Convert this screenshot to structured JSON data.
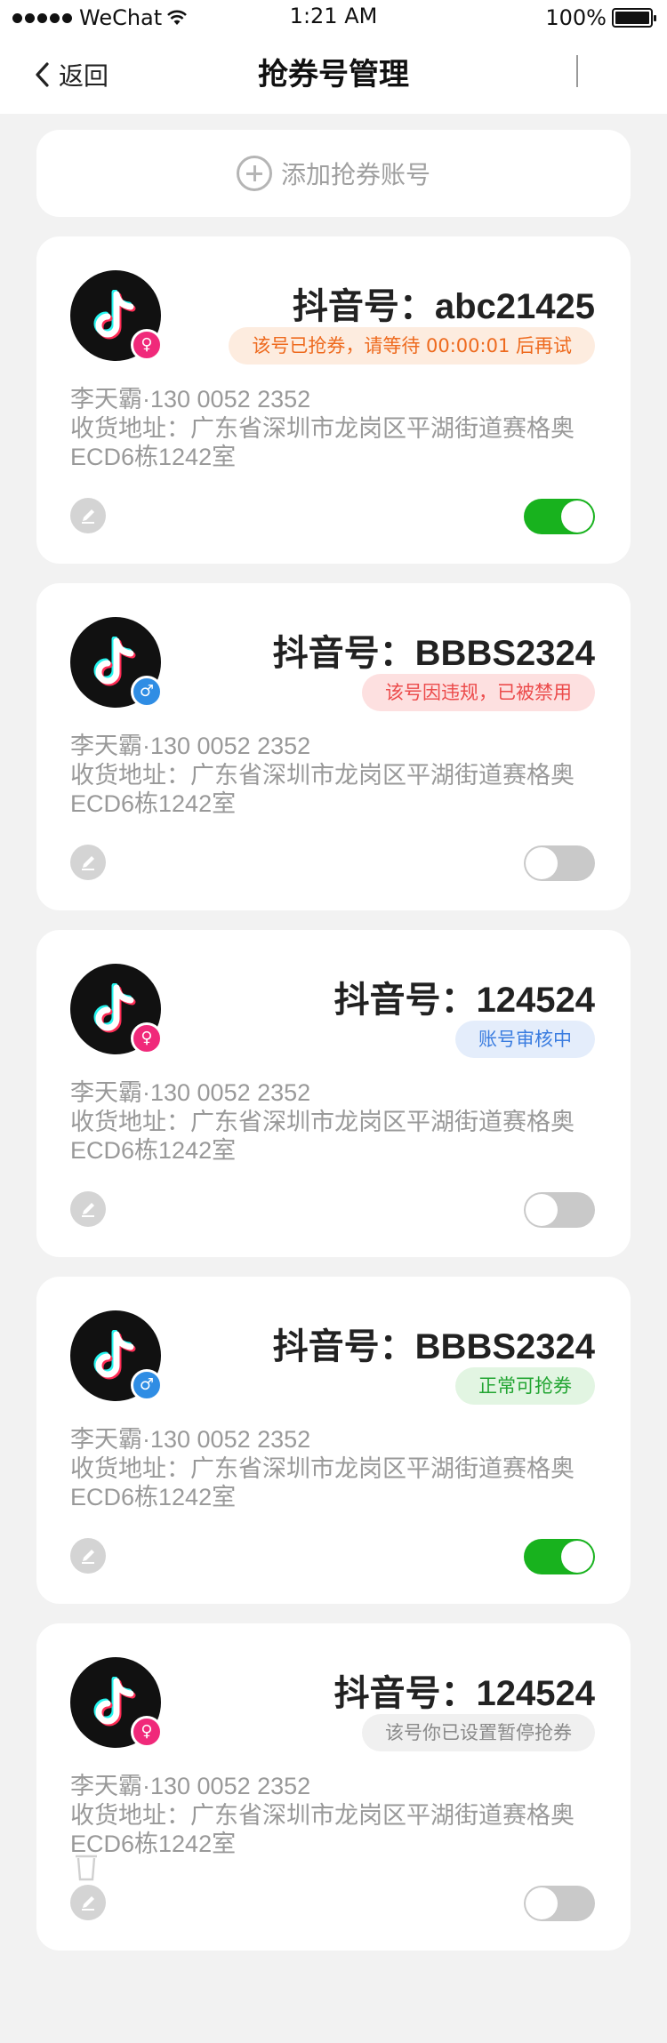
{
  "status_bar": {
    "carrier": "WeChat",
    "time": "1:21 AM",
    "battery": "100%"
  },
  "nav": {
    "back_label": "返回",
    "title": "抢券号管理"
  },
  "add_button": {
    "label": "添加抢券账号"
  },
  "colors": {
    "toggle_on": "#18b21e",
    "toggle_off": "#c9c9c9",
    "female": "#f0297a",
    "male": "#2f8de4"
  },
  "cards": [
    {
      "account": "抖音号：abc21425",
      "gender": "female",
      "status": "该号已抢券，请等待 00:00:01 后再试",
      "status_type": "orange",
      "contact": "李天霸·130 0052 2352",
      "address": "收货地址：广东省深圳市龙岗区平湖街道赛格奥ECD6栋1242室",
      "enabled": true
    },
    {
      "account": "抖音号：BBBS2324",
      "gender": "male",
      "status": "该号因违规，已被禁用",
      "status_type": "red",
      "contact": "李天霸·130 0052 2352",
      "address": "收货地址：广东省深圳市龙岗区平湖街道赛格奥ECD6栋1242室",
      "enabled": false
    },
    {
      "account": "抖音号：124524",
      "gender": "female",
      "status": "账号审核中",
      "status_type": "blue",
      "contact": "李天霸·130 0052 2352",
      "address": "收货地址：广东省深圳市龙岗区平湖街道赛格奥ECD6栋1242室",
      "enabled": false
    },
    {
      "account": "抖音号：BBBS2324",
      "gender": "male",
      "status": "正常可抢券",
      "status_type": "green",
      "contact": "李天霸·130 0052 2352",
      "address": "收货地址：广东省深圳市龙岗区平湖街道赛格奥ECD6栋1242室",
      "enabled": true
    },
    {
      "account": "抖音号：124524",
      "gender": "female",
      "status": "该号你已设置暂停抢券",
      "status_type": "gray",
      "contact": "李天霸·130 0052 2352",
      "address": "收货地址：广东省深圳市龙岗区平湖街道赛格奥ECD6栋1242室",
      "enabled": false
    }
  ]
}
